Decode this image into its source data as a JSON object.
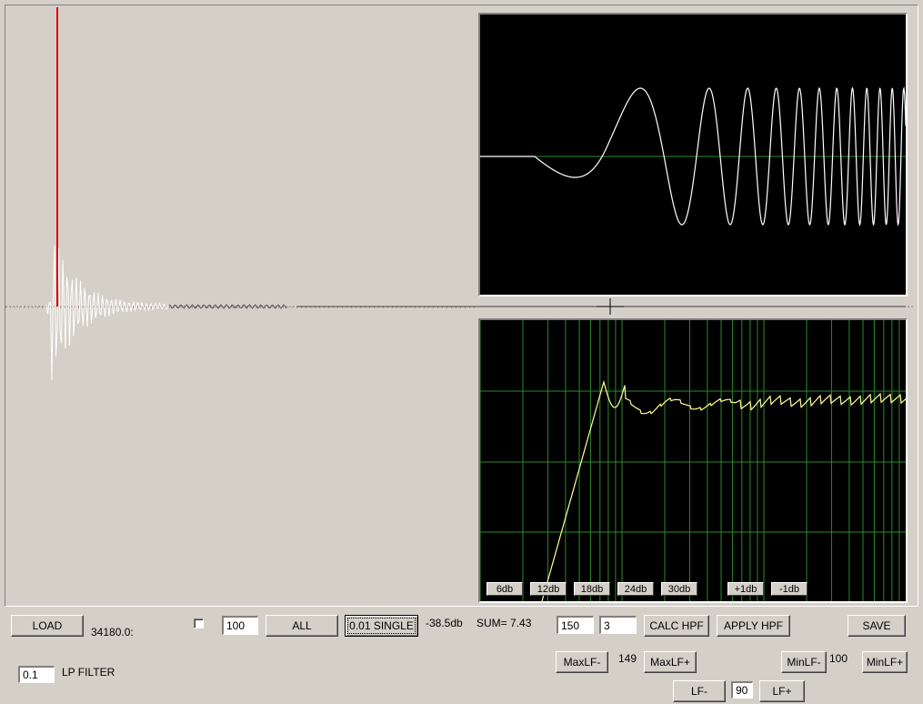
{
  "colors": {
    "background": "#d4d0c8",
    "scope_bg": "#000000",
    "waveform": "#ffffff",
    "grid": "#2a8a2a",
    "impulse_peak": "#e00000",
    "response_curve": "#ffff99"
  },
  "db_buttons": [
    "6db",
    "12db",
    "18db",
    "24db",
    "30db",
    "+1db",
    "-1db"
  ],
  "controls": {
    "load_label": "LOAD",
    "load_value": "34180.0:",
    "checkbox_checked": false,
    "count_value": "100",
    "all_label": "ALL",
    "single_label": "0.01 SINGLE",
    "db_readout": "-38.5db",
    "sum_readout": "SUM= 7.43",
    "hpf_freq_value": "150",
    "hpf_order_value": "3",
    "calc_hpf_label": "CALC  HPF",
    "apply_hpf_label": "APPLY  HPF",
    "save_label": "SAVE",
    "lp_value": "0.1",
    "lp_label": "LP FILTER",
    "maxlf_minus_label": "MaxLF-",
    "maxlf_value": "149",
    "maxlf_plus_label": "MaxLF+",
    "minlf_minus_label": "MinLF-",
    "minlf_value": "100",
    "minlf_plus_label": "MinLF+",
    "lf_minus_label": "LF-",
    "lf_value": "90",
    "lf_plus_label": "LF+"
  }
}
